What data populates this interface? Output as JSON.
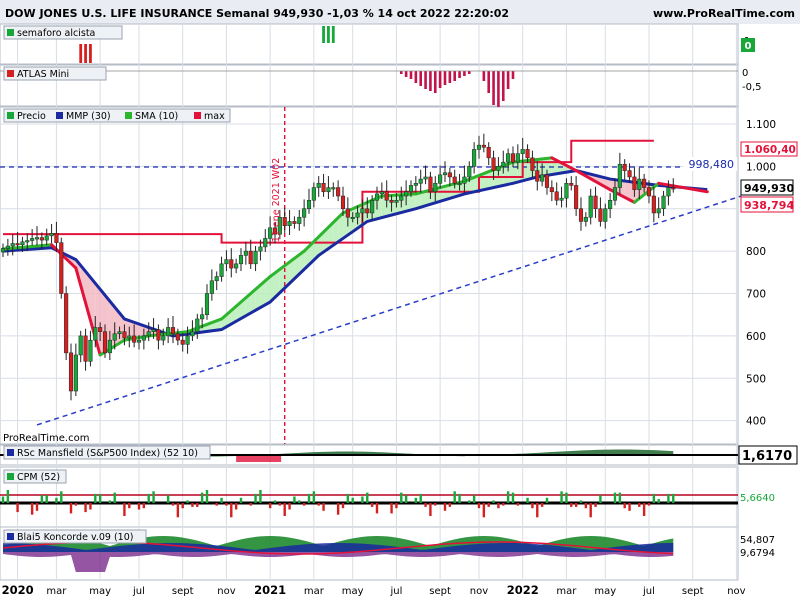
{
  "header": {
    "title": "DOW JONES U.S. LIFE INSURANCE Semanal 949,930 -1,03 % 14 oct 2022 22:20:02",
    "website": "www.ProRealTime.com"
  },
  "panels": {
    "semaforo": {
      "label": "semaforo alcista",
      "value": "0",
      "ticks": [
        "1",
        "0"
      ]
    },
    "atlas": {
      "label": "ATLAS Mini",
      "ticks": [
        "0",
        "-0,5"
      ]
    },
    "price": {
      "legend": [
        "Precio",
        "MMP (30)",
        "SMA (10)",
        "max"
      ],
      "annotation": "11 ene 2021 W02",
      "watermark": "ProRealTime.com",
      "tag_dashed": "998,480",
      "tag_max": "1.060,40",
      "tag_last": "949,930",
      "tag_sma": "938,794"
    },
    "rsc": {
      "label": "RSc Mansfield (S&P500 Index) (52 10)",
      "value": "1,6170"
    },
    "cpm": {
      "label": "CPM (52)",
      "value": "5,6640"
    },
    "koncorde": {
      "label": "Blai5 Koncorde v.09 (10)",
      "value_top": "54,807",
      "value_bottom": "9,6794"
    }
  },
  "x_labels": [
    {
      "text": "2020",
      "bold": true,
      "w": 3
    },
    {
      "text": "mar",
      "bold": false,
      "w": 11
    },
    {
      "text": "may",
      "bold": false,
      "w": 20
    },
    {
      "text": "jul",
      "bold": false,
      "w": 28
    },
    {
      "text": "sept",
      "bold": false,
      "w": 37
    },
    {
      "text": "nov",
      "bold": false,
      "w": 46
    },
    {
      "text": "2021",
      "bold": true,
      "w": 55
    },
    {
      "text": "mar",
      "bold": false,
      "w": 64
    },
    {
      "text": "may",
      "bold": false,
      "w": 72
    },
    {
      "text": "jul",
      "bold": false,
      "w": 81
    },
    {
      "text": "sept",
      "bold": false,
      "w": 90
    },
    {
      "text": "nov",
      "bold": false,
      "w": 98
    },
    {
      "text": "2022",
      "bold": true,
      "w": 107
    },
    {
      "text": "mar",
      "bold": false,
      "w": 116
    },
    {
      "text": "may",
      "bold": false,
      "w": 124
    },
    {
      "text": "jul",
      "bold": false,
      "w": 133
    },
    {
      "text": "sept",
      "bold": false,
      "w": 142
    },
    {
      "text": "nov",
      "bold": false,
      "w": 151
    }
  ],
  "chart_data": {
    "type": "candlestick",
    "title": "DOW JONES U.S. LIFE INSURANCE Semanal 949,930 -1,03 % 14 oct 2022 22:20:02",
    "y_ticks": [
      400,
      500,
      600,
      700,
      800,
      900,
      1000,
      1100
    ],
    "y_range": [
      345,
      1140
    ],
    "date_axis": [
      "2020",
      "mar",
      "may",
      "jul",
      "sept",
      "nov",
      "2021",
      "mar",
      "may",
      "jul",
      "sept",
      "nov",
      "2022",
      "mar",
      "may",
      "jul",
      "sept",
      "nov"
    ],
    "week_span": [
      0,
      145
    ],
    "closes": [
      806,
      812,
      818,
      815,
      822,
      825,
      830,
      832,
      826,
      836,
      842,
      820,
      700,
      560,
      470,
      555,
      600,
      540,
      590,
      620,
      610,
      560,
      590,
      605,
      610,
      595,
      600,
      585,
      590,
      600,
      610,
      615,
      590,
      600,
      620,
      605,
      590,
      580,
      600,
      610,
      640,
      650,
      700,
      730,
      740,
      770,
      780,
      760,
      770,
      790,
      800,
      770,
      800,
      810,
      830,
      855,
      840,
      880,
      860,
      870,
      865,
      880,
      900,
      920,
      950,
      960,
      940,
      950,
      950,
      930,
      900,
      880,
      880,
      890,
      900,
      890,
      920,
      935,
      940,
      920,
      915,
      920,
      930,
      940,
      955,
      960,
      970,
      975,
      940,
      960,
      980,
      985,
      975,
      960,
      960,
      975,
      1000,
      1040,
      1050,
      1045,
      1020,
      990,
      1000,
      1010,
      1030,
      1010,
      1030,
      1040,
      1020,
      990,
      965,
      980,
      950,
      940,
      920,
      925,
      960,
      955,
      900,
      870,
      880,
      930,
      900,
      870,
      900,
      920,
      950,
      1005,
      990,
      975,
      945,
      970,
      950,
      930,
      890,
      900,
      930,
      950,
      949.93
    ],
    "max_steps": [
      [
        0,
        840
      ],
      [
        45,
        820
      ],
      [
        74,
        940
      ],
      [
        98,
        975
      ],
      [
        107,
        1010
      ],
      [
        117,
        1060.4
      ],
      [
        134,
        1060.4
      ]
    ],
    "mmp30": [
      [
        0,
        800
      ],
      [
        10,
        808
      ],
      [
        15,
        780
      ],
      [
        25,
        640
      ],
      [
        35,
        600
      ],
      [
        45,
        615
      ],
      [
        55,
        680
      ],
      [
        65,
        790
      ],
      [
        75,
        870
      ],
      [
        85,
        900
      ],
      [
        95,
        935
      ],
      [
        105,
        960
      ],
      [
        110,
        975
      ],
      [
        118,
        990
      ],
      [
        125,
        970
      ],
      [
        135,
        955
      ],
      [
        145,
        945
      ]
    ],
    "sma10": [
      [
        0,
        805
      ],
      [
        10,
        815
      ],
      [
        15,
        760
      ],
      [
        20,
        555
      ],
      [
        25,
        590
      ],
      [
        30,
        600
      ],
      [
        38,
        610
      ],
      [
        45,
        640
      ],
      [
        55,
        740
      ],
      [
        62,
        800
      ],
      [
        70,
        890
      ],
      [
        78,
        930
      ],
      [
        85,
        935
      ],
      [
        95,
        965
      ],
      [
        105,
        1010
      ],
      [
        113,
        1020
      ],
      [
        118,
        990
      ],
      [
        125,
        945
      ],
      [
        130,
        915
      ],
      [
        135,
        960
      ],
      [
        145,
        940
      ]
    ],
    "trendline": [
      [
        7,
        390
      ],
      [
        152,
        930
      ]
    ],
    "dashed_level": 998.48,
    "vertical_marker_week": 58,
    "series": [
      {
        "name": "Precio",
        "color": "#18a83a"
      },
      {
        "name": "MMP (30)",
        "color": "#1a2aa0"
      },
      {
        "name": "SMA (10)",
        "color": "#2db52d"
      },
      {
        "name": "max",
        "color": "#e3123a"
      }
    ]
  },
  "colors": {
    "up": "#18a83a",
    "down": "#d62020",
    "grid": "#d8dde6",
    "bg": "#ffffff",
    "accent": "#0000c0"
  }
}
